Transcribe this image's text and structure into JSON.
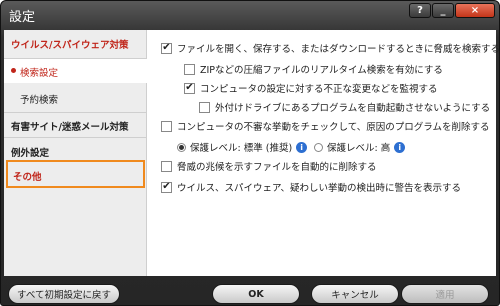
{
  "window": {
    "title": "設定"
  },
  "window_controls": {
    "help": "?",
    "minimize": "_",
    "close": "×"
  },
  "sidebar": {
    "category_virus": "ウイルス/スパイウェア対策",
    "sub_scan": "検索設定",
    "sub_schedule": "予約検索",
    "category_web": "有害サイト/迷惑メール対策",
    "category_exception": "例外設定",
    "category_other": "その他"
  },
  "options": {
    "scan_on_access": "ファイルを開く、保存する、またはダウンロードするときに脅威を検索する",
    "zip_realtime": "ZIPなどの圧縮ファイルのリアルタイム検索を有効にする",
    "monitor_changes": "コンピュータの設定に対する不正な変更などを監視する",
    "block_autorun": "外付けドライブにあるプログラムを自動起動させないようにする",
    "behavior_check": "コンピュータの不審な挙動をチェックして、原因のプログラムを削除する",
    "protection_standard": "保護レベル: 標準 (推奨)",
    "protection_high": "保護レベル: 高",
    "auto_delete": "脅威の兆候を示すファイルを自動的に削除する",
    "warn_on_detect": "ウイルス、スパイウェア、疑わしい挙動の検出時に警告を表示する"
  },
  "footer": {
    "reset": "すべて初期設定に戻す",
    "ok": "OK",
    "cancel": "キャンセル",
    "apply": "適用"
  },
  "colors": {
    "accent_red": "#c0251a",
    "focus_orange": "#f08a1e",
    "info_blue": "#2d6fd1"
  }
}
